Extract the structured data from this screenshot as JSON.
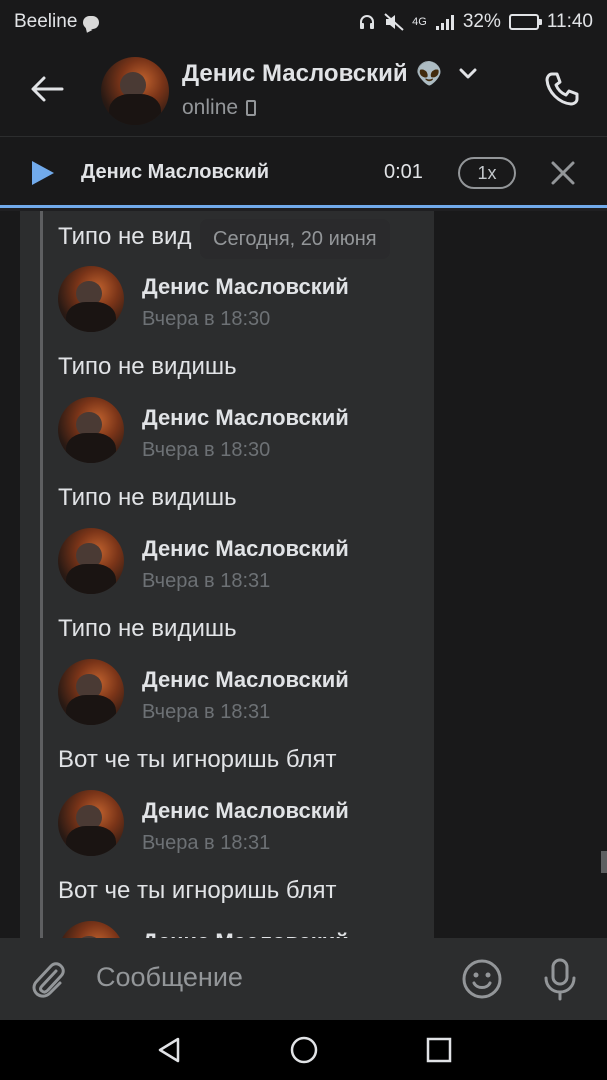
{
  "status_bar": {
    "carrier": "Beeline",
    "network": "4G",
    "battery_percent": "32%",
    "battery_level": 0.32,
    "time": "11:40",
    "icons": [
      "chat-notification-icon",
      "headphones-icon",
      "mute-icon",
      "signal-icon",
      "battery-icon"
    ]
  },
  "header": {
    "back_icon": "arrow-left-icon",
    "contact_name": "Денис Масловский",
    "name_emoji": "👽",
    "status": "online",
    "call_icon": "phone-icon"
  },
  "player": {
    "track_name": "Денис Масловский",
    "time": "0:01",
    "speed": "1x"
  },
  "chat": {
    "date_badge": "Сегодня, 20 июня",
    "top_partial_text": "Типо не вид",
    "items": [
      {
        "kind": "header",
        "name": "Денис Масловский",
        "time": "Вчера в 18:30"
      },
      {
        "kind": "text",
        "text": "Типо не видишь"
      },
      {
        "kind": "header",
        "name": "Денис Масловский",
        "time": "Вчера в 18:30"
      },
      {
        "kind": "text",
        "text": "Типо не видишь"
      },
      {
        "kind": "header",
        "name": "Денис Масловский",
        "time": "Вчера в 18:31"
      },
      {
        "kind": "text",
        "text": "Типо не видишь"
      },
      {
        "kind": "header",
        "name": "Денис Масловский",
        "time": "Вчера в 18:31"
      },
      {
        "kind": "text",
        "text": "Вот че ты игноришь блят"
      },
      {
        "kind": "header",
        "name": "Денис Масловский",
        "time": "Вчера в 18:31"
      },
      {
        "kind": "text",
        "text": "Вот че ты игноришь блят"
      },
      {
        "kind": "header",
        "name": "Денис Масловский",
        "time": ""
      }
    ]
  },
  "composer": {
    "placeholder": "Сообщение",
    "attach_icon": "paperclip-icon",
    "emoji_icon": "smiley-icon",
    "mic_icon": "microphone-icon"
  },
  "nav": {
    "icons": [
      "nav-back-icon",
      "nav-home-icon",
      "nav-recent-icon"
    ]
  },
  "colors": {
    "accent": "#71aaeb",
    "background": "#19191a",
    "card": "#2c2d2e",
    "text_primary": "#e1e3e6",
    "text_secondary": "#939699"
  }
}
